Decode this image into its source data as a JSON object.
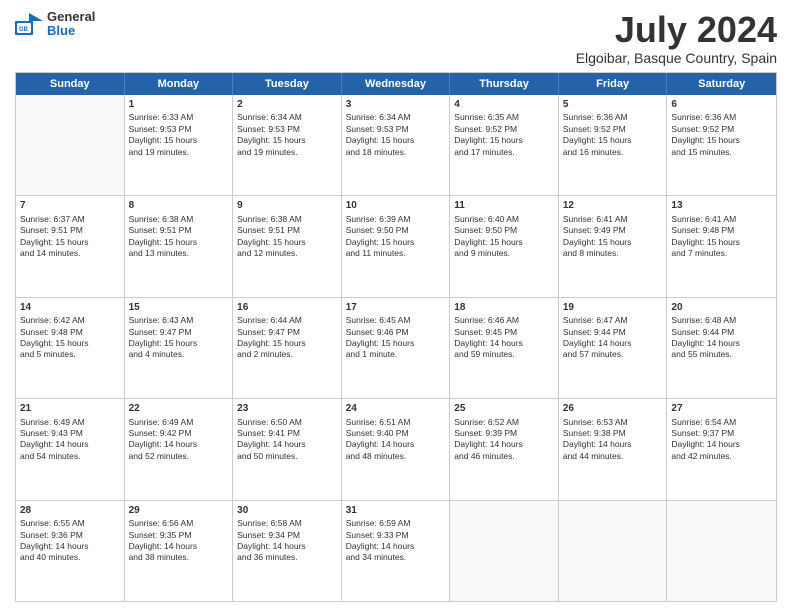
{
  "header": {
    "logo_general": "General",
    "logo_blue": "Blue",
    "month_year": "July 2024",
    "location": "Elgoibar, Basque Country, Spain"
  },
  "calendar": {
    "days": [
      "Sunday",
      "Monday",
      "Tuesday",
      "Wednesday",
      "Thursday",
      "Friday",
      "Saturday"
    ],
    "weeks": [
      [
        {
          "day": "",
          "empty": true,
          "lines": []
        },
        {
          "day": "1",
          "empty": false,
          "lines": [
            "Sunrise: 6:33 AM",
            "Sunset: 9:53 PM",
            "Daylight: 15 hours",
            "and 19 minutes."
          ]
        },
        {
          "day": "2",
          "empty": false,
          "lines": [
            "Sunrise: 6:34 AM",
            "Sunset: 9:53 PM",
            "Daylight: 15 hours",
            "and 19 minutes."
          ]
        },
        {
          "day": "3",
          "empty": false,
          "lines": [
            "Sunrise: 6:34 AM",
            "Sunset: 9:53 PM",
            "Daylight: 15 hours",
            "and 18 minutes."
          ]
        },
        {
          "day": "4",
          "empty": false,
          "lines": [
            "Sunrise: 6:35 AM",
            "Sunset: 9:52 PM",
            "Daylight: 15 hours",
            "and 17 minutes."
          ]
        },
        {
          "day": "5",
          "empty": false,
          "lines": [
            "Sunrise: 6:36 AM",
            "Sunset: 9:52 PM",
            "Daylight: 15 hours",
            "and 16 minutes."
          ]
        },
        {
          "day": "6",
          "empty": false,
          "lines": [
            "Sunrise: 6:36 AM",
            "Sunset: 9:52 PM",
            "Daylight: 15 hours",
            "and 15 minutes."
          ]
        }
      ],
      [
        {
          "day": "7",
          "empty": false,
          "lines": [
            "Sunrise: 6:37 AM",
            "Sunset: 9:51 PM",
            "Daylight: 15 hours",
            "and 14 minutes."
          ]
        },
        {
          "day": "8",
          "empty": false,
          "lines": [
            "Sunrise: 6:38 AM",
            "Sunset: 9:51 PM",
            "Daylight: 15 hours",
            "and 13 minutes."
          ]
        },
        {
          "day": "9",
          "empty": false,
          "lines": [
            "Sunrise: 6:38 AM",
            "Sunset: 9:51 PM",
            "Daylight: 15 hours",
            "and 12 minutes."
          ]
        },
        {
          "day": "10",
          "empty": false,
          "lines": [
            "Sunrise: 6:39 AM",
            "Sunset: 9:50 PM",
            "Daylight: 15 hours",
            "and 11 minutes."
          ]
        },
        {
          "day": "11",
          "empty": false,
          "lines": [
            "Sunrise: 6:40 AM",
            "Sunset: 9:50 PM",
            "Daylight: 15 hours",
            "and 9 minutes."
          ]
        },
        {
          "day": "12",
          "empty": false,
          "lines": [
            "Sunrise: 6:41 AM",
            "Sunset: 9:49 PM",
            "Daylight: 15 hours",
            "and 8 minutes."
          ]
        },
        {
          "day": "13",
          "empty": false,
          "lines": [
            "Sunrise: 6:41 AM",
            "Sunset: 9:48 PM",
            "Daylight: 15 hours",
            "and 7 minutes."
          ]
        }
      ],
      [
        {
          "day": "14",
          "empty": false,
          "lines": [
            "Sunrise: 6:42 AM",
            "Sunset: 9:48 PM",
            "Daylight: 15 hours",
            "and 5 minutes."
          ]
        },
        {
          "day": "15",
          "empty": false,
          "lines": [
            "Sunrise: 6:43 AM",
            "Sunset: 9:47 PM",
            "Daylight: 15 hours",
            "and 4 minutes."
          ]
        },
        {
          "day": "16",
          "empty": false,
          "lines": [
            "Sunrise: 6:44 AM",
            "Sunset: 9:47 PM",
            "Daylight: 15 hours",
            "and 2 minutes."
          ]
        },
        {
          "day": "17",
          "empty": false,
          "lines": [
            "Sunrise: 6:45 AM",
            "Sunset: 9:46 PM",
            "Daylight: 15 hours",
            "and 1 minute."
          ]
        },
        {
          "day": "18",
          "empty": false,
          "lines": [
            "Sunrise: 6:46 AM",
            "Sunset: 9:45 PM",
            "Daylight: 14 hours",
            "and 59 minutes."
          ]
        },
        {
          "day": "19",
          "empty": false,
          "lines": [
            "Sunrise: 6:47 AM",
            "Sunset: 9:44 PM",
            "Daylight: 14 hours",
            "and 57 minutes."
          ]
        },
        {
          "day": "20",
          "empty": false,
          "lines": [
            "Sunrise: 6:48 AM",
            "Sunset: 9:44 PM",
            "Daylight: 14 hours",
            "and 55 minutes."
          ]
        }
      ],
      [
        {
          "day": "21",
          "empty": false,
          "lines": [
            "Sunrise: 6:49 AM",
            "Sunset: 9:43 PM",
            "Daylight: 14 hours",
            "and 54 minutes."
          ]
        },
        {
          "day": "22",
          "empty": false,
          "lines": [
            "Sunrise: 6:49 AM",
            "Sunset: 9:42 PM",
            "Daylight: 14 hours",
            "and 52 minutes."
          ]
        },
        {
          "day": "23",
          "empty": false,
          "lines": [
            "Sunrise: 6:50 AM",
            "Sunset: 9:41 PM",
            "Daylight: 14 hours",
            "and 50 minutes."
          ]
        },
        {
          "day": "24",
          "empty": false,
          "lines": [
            "Sunrise: 6:51 AM",
            "Sunset: 9:40 PM",
            "Daylight: 14 hours",
            "and 48 minutes."
          ]
        },
        {
          "day": "25",
          "empty": false,
          "lines": [
            "Sunrise: 6:52 AM",
            "Sunset: 9:39 PM",
            "Daylight: 14 hours",
            "and 46 minutes."
          ]
        },
        {
          "day": "26",
          "empty": false,
          "lines": [
            "Sunrise: 6:53 AM",
            "Sunset: 9:38 PM",
            "Daylight: 14 hours",
            "and 44 minutes."
          ]
        },
        {
          "day": "27",
          "empty": false,
          "lines": [
            "Sunrise: 6:54 AM",
            "Sunset: 9:37 PM",
            "Daylight: 14 hours",
            "and 42 minutes."
          ]
        }
      ],
      [
        {
          "day": "28",
          "empty": false,
          "lines": [
            "Sunrise: 6:55 AM",
            "Sunset: 9:36 PM",
            "Daylight: 14 hours",
            "and 40 minutes."
          ]
        },
        {
          "day": "29",
          "empty": false,
          "lines": [
            "Sunrise: 6:56 AM",
            "Sunset: 9:35 PM",
            "Daylight: 14 hours",
            "and 38 minutes."
          ]
        },
        {
          "day": "30",
          "empty": false,
          "lines": [
            "Sunrise: 6:58 AM",
            "Sunset: 9:34 PM",
            "Daylight: 14 hours",
            "and 36 minutes."
          ]
        },
        {
          "day": "31",
          "empty": false,
          "lines": [
            "Sunrise: 6:59 AM",
            "Sunset: 9:33 PM",
            "Daylight: 14 hours",
            "and 34 minutes."
          ]
        },
        {
          "day": "",
          "empty": true,
          "lines": []
        },
        {
          "day": "",
          "empty": true,
          "lines": []
        },
        {
          "day": "",
          "empty": true,
          "lines": []
        }
      ]
    ]
  }
}
